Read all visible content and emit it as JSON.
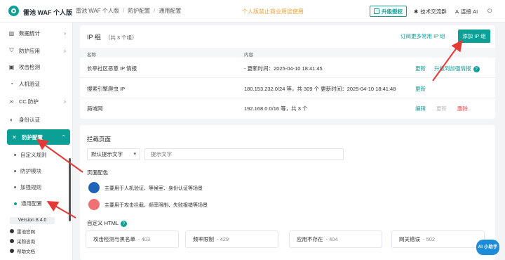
{
  "header": {
    "brand": "雷池 WAF 个人版",
    "breadcrumb": [
      "雷池 WAF 个人版",
      "防护配置",
      "通用配置"
    ],
    "notice": "个人版禁止商业用途使用",
    "upgrade": "升级授权",
    "tech_group": "技术交流群",
    "login": "连接 AI"
  },
  "sidebar": {
    "items": [
      {
        "label": "数据统计",
        "icon": "chart-icon",
        "arrow": "›"
      },
      {
        "label": "防护应用",
        "icon": "shield-icon",
        "arrow": "›"
      },
      {
        "label": "攻击检测",
        "icon": "box-icon",
        "arrow": ""
      },
      {
        "label": "人机验证",
        "icon": "user-icon",
        "arrow": ""
      },
      {
        "label": "CC 防护",
        "icon": "link-icon",
        "arrow": "›"
      },
      {
        "label": "身份认证",
        "icon": "id-icon",
        "arrow": ""
      },
      {
        "label": "防护配置",
        "icon": "tools-icon",
        "arrow": "⌃"
      }
    ],
    "subitems": [
      "自定义规则",
      "防护模块",
      "加强规则",
      "通用配置"
    ],
    "version": "Version 8.4.0",
    "footer_links": [
      "雷池官网",
      "采购咨询",
      "帮助文档"
    ]
  },
  "ip_group": {
    "title": "IP 组",
    "count": "（共 3 个组）",
    "more_link": "订阅更多常用 IP 组",
    "add_button": "添加 IP 组",
    "columns": [
      "名称",
      "内容"
    ],
    "rows": [
      {
        "name": "长亭社区恶意 IP 情报",
        "content": "-   更新时间：2025-04-10 18:41:45",
        "actions": [
          "更新",
          "升级到加强情报"
        ]
      },
      {
        "name": "搜索引擎爬虫 IP",
        "content": "180.153.232.0/24 等，共 309 个     更新时间：2025-04-10 18:41:48",
        "actions": [
          "更新"
        ]
      },
      {
        "name": "局域网",
        "content": "192.168.0.0/16 等，共 3 个",
        "actions": [
          "编辑",
          "更新",
          "删除"
        ]
      }
    ]
  },
  "block_page": {
    "title": "拦截页面",
    "select_value": "默认提示文字",
    "input_placeholder": "提示文字",
    "color_title": "页面配色",
    "colors": [
      {
        "color": "#1e63b8",
        "label": "主要用于人机验证、等候室、身份认证等场景"
      },
      {
        "color": "#f07171",
        "label": "主要用于攻击拦截、频率限制、失败报错等场景"
      }
    ],
    "html_title": "自定义 HTML",
    "templates": [
      {
        "label": "攻击检测与黑名单",
        "code": "- 403"
      },
      {
        "label": "频率限制",
        "code": "- 429"
      },
      {
        "label": "应用不存在",
        "code": "- 404"
      },
      {
        "label": "网关错误",
        "code": "- 502"
      }
    ]
  },
  "ai_badge": "AI 小助手",
  "accent": "#0b9f95",
  "annotation_color": "#e53935"
}
